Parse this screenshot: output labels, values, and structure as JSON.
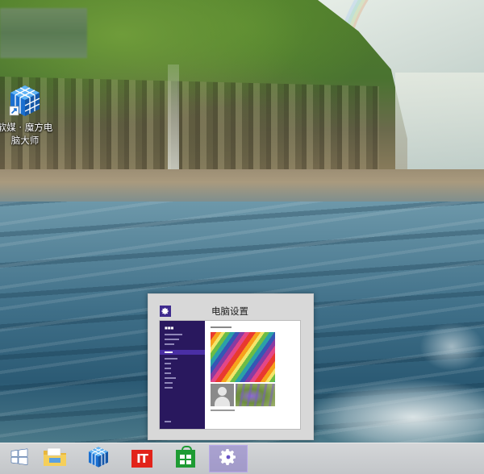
{
  "desktop": {
    "icons": [
      {
        "label": "软媒 · 魔方电脑大师",
        "icon": "mofang-cube-icon"
      }
    ]
  },
  "preview": {
    "title": "电脑设置",
    "icon": "gear-icon",
    "accent": "#3f2b8e"
  },
  "taskbar": {
    "items": [
      {
        "name": "start",
        "icon": "windows-logo-icon",
        "active": false
      },
      {
        "name": "file-explorer",
        "icon": "folder-icon",
        "active": false
      },
      {
        "name": "mofang",
        "icon": "mofang-cube-icon",
        "active": false
      },
      {
        "name": "ithome",
        "icon": "it-logo-icon",
        "text": "IT",
        "active": false
      },
      {
        "name": "store",
        "icon": "store-bag-icon",
        "active": false
      },
      {
        "name": "pc-settings",
        "icon": "gear-icon",
        "active": true
      }
    ],
    "active_color": "#6a55c8"
  }
}
